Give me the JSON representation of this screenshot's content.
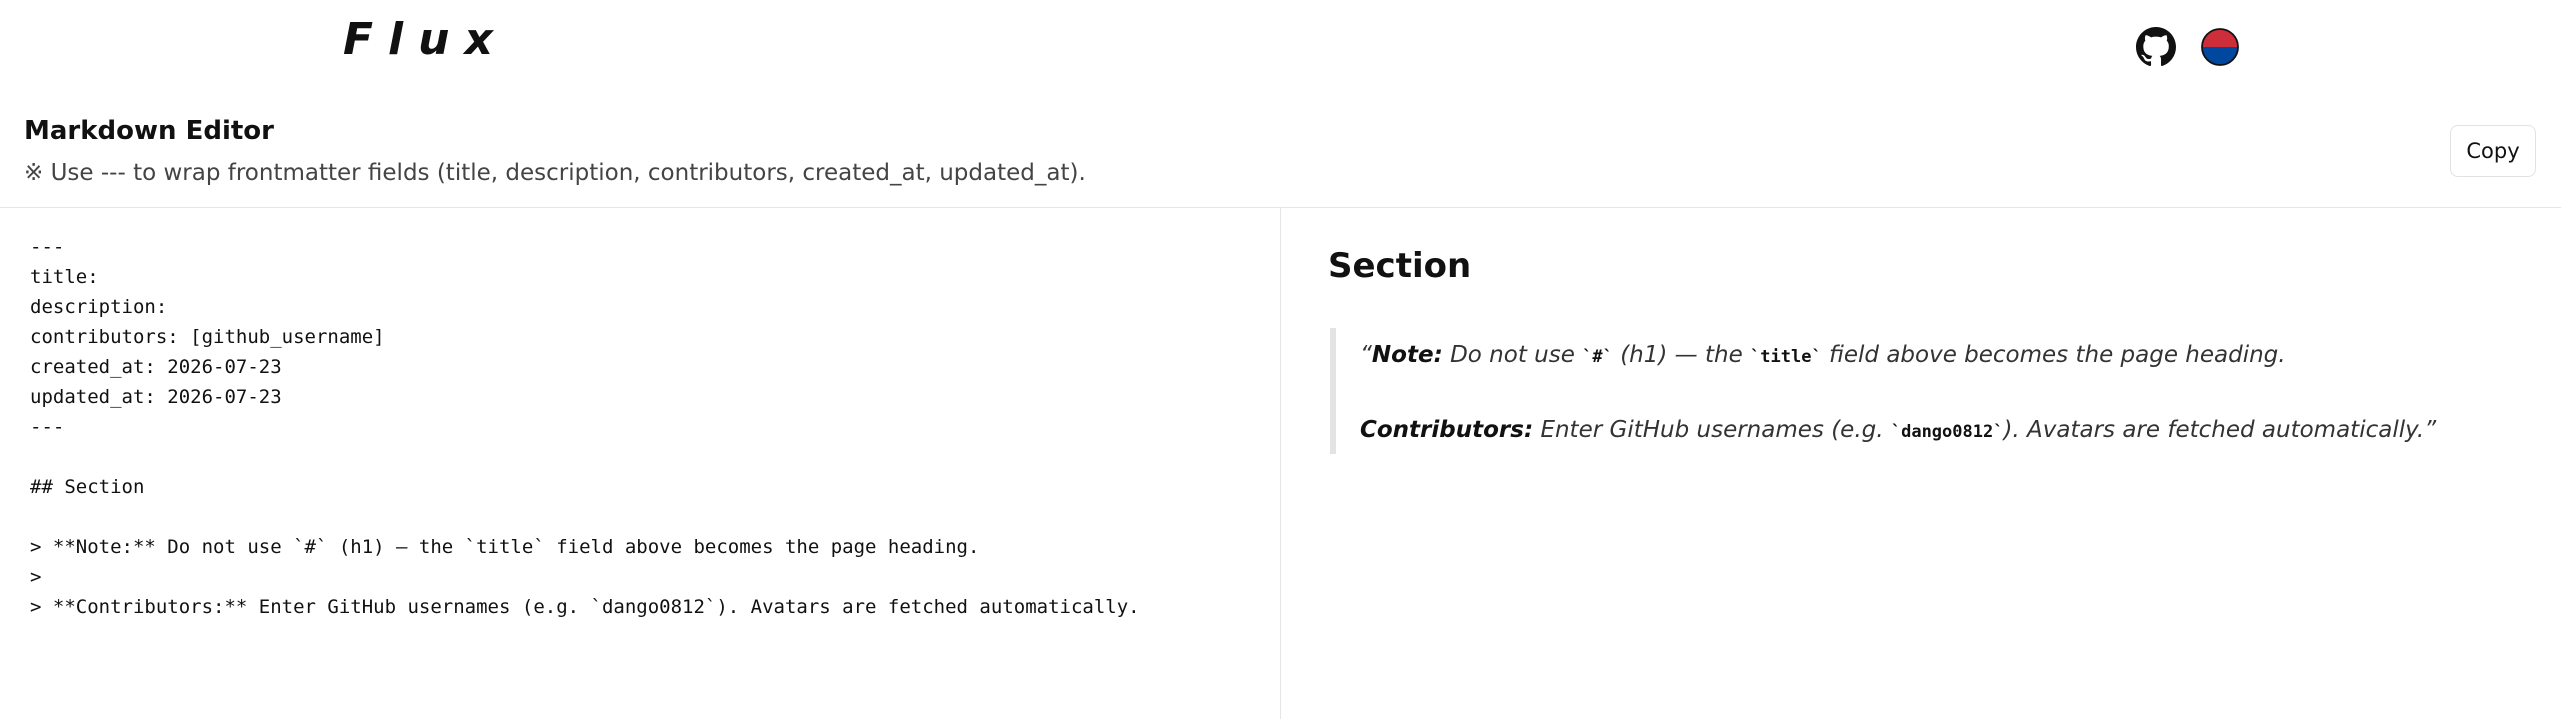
{
  "header": {
    "brand": "Flux",
    "icons": [
      "github-icon",
      "language-flag-icon"
    ]
  },
  "editor": {
    "title": "Markdown Editor",
    "hint": "※ Use --- to wrap frontmatter fields (title, description, contributors, created_at, updated_at).",
    "copy_label": "Copy"
  },
  "source": {
    "text": "---\ntitle:\ndescription:\ncontributors: [github_username]\ncreated_at: 2026-07-23\nupdated_at: 2026-07-23\n---\n\n## Section\n\n> **Note:** Do not use `#` (h1) — the `title` field above becomes the page heading.\n>\n> **Contributors:** Enter GitHub usernames (e.g. `dango0812`). Avatars are fetched automatically."
  },
  "preview": {
    "heading": "Section",
    "note": {
      "open_quote": "“",
      "label": "Note:",
      "text_a": " Do not use ",
      "code_a": "`#`",
      "text_b": " (h1) — the ",
      "code_b": "`title`",
      "text_c": " field above becomes the page heading."
    },
    "contributors": {
      "label": "Contributors:",
      "text_a": " Enter GitHub usernames (e.g. ",
      "code_a": "`dango0812`",
      "text_b": "). Avatars are fetched automatically.",
      "close_quote": "”"
    }
  },
  "colors": {
    "background": "#ffffff",
    "text": "#111111",
    "muted_text": "#444444",
    "border": "#e6e6e6",
    "flag_red": "#cd2e3a",
    "flag_blue": "#0047a0"
  }
}
